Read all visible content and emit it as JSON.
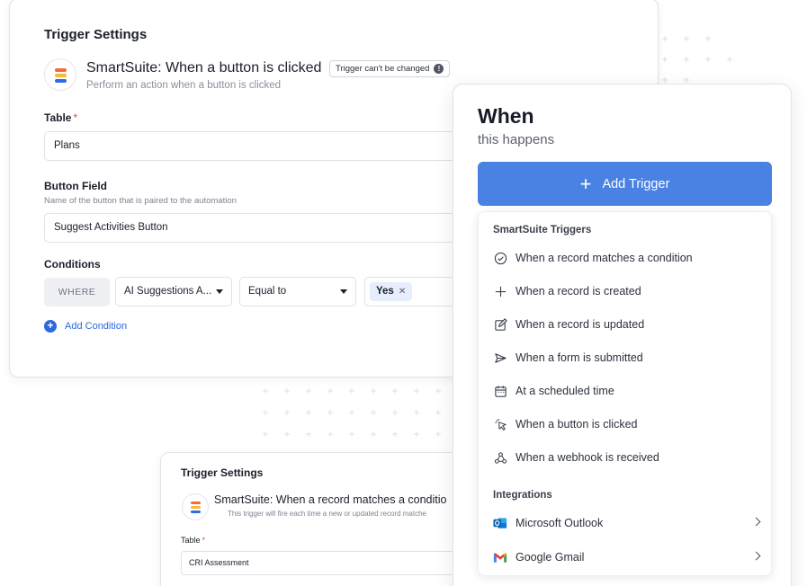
{
  "main_card": {
    "title": "Trigger Settings",
    "trigger_name": "SmartSuite: When a button is clicked",
    "trigger_description": "Perform an action when a button is clicked",
    "badge": "Trigger can't be changed",
    "table_label": "Table",
    "required_mark": "*",
    "table_value": "Plans",
    "button_field_label": "Button Field",
    "button_field_help": "Name of the button that is paired to the automation",
    "button_field_value": "Suggest Activities Button",
    "conditions_label": "Conditions",
    "where": "WHERE",
    "condition_field": "AI Suggestions A...",
    "condition_operator": "Equal to",
    "condition_value": "Yes",
    "add_condition": "Add Condition"
  },
  "secondary_card": {
    "title": "Trigger Settings",
    "trigger_name": "SmartSuite: When a record matches a conditio",
    "trigger_description": "This trigger will fire each time a new or updated record matche",
    "table_label": "Table",
    "required_mark": "*",
    "table_value": "CRI Assessment"
  },
  "when_panel": {
    "title": "When",
    "subtitle": "this happens",
    "add_trigger": "Add Trigger",
    "smartsuite_heading": "SmartSuite Triggers",
    "triggers": [
      {
        "label": "When a record matches a condition",
        "icon": "check-circle-icon"
      },
      {
        "label": "When a record is created",
        "icon": "plus-icon"
      },
      {
        "label": "When a record is updated",
        "icon": "edit-icon"
      },
      {
        "label": "When a form is submitted",
        "icon": "send-icon"
      },
      {
        "label": "At a scheduled time",
        "icon": "calendar-icon"
      },
      {
        "label": "When a button is clicked",
        "icon": "pointer-click-icon"
      },
      {
        "label": "When a webhook is received",
        "icon": "webhook-icon"
      }
    ],
    "integrations_heading": "Integrations",
    "integrations": [
      {
        "label": "Microsoft Outlook",
        "icon": "outlook-icon"
      },
      {
        "label": "Google Gmail",
        "icon": "gmail-icon"
      }
    ]
  }
}
